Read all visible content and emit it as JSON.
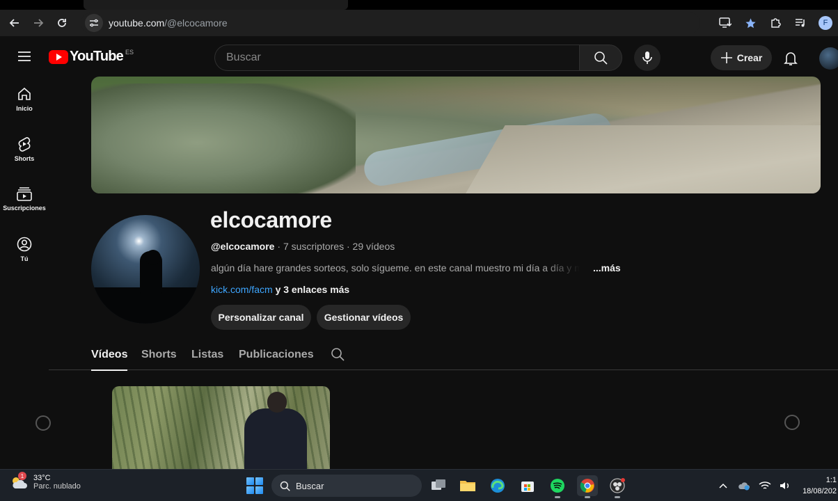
{
  "browser": {
    "url_host": "youtube.com",
    "url_path": "/@elcocamore",
    "profile_initial": "F"
  },
  "masthead": {
    "logo_text": "YouTube",
    "country_code": "ES",
    "search_placeholder": "Buscar",
    "create_label": "Crear"
  },
  "guide": {
    "items": [
      {
        "label": "Inicio",
        "icon": "home-icon"
      },
      {
        "label": "Shorts",
        "icon": "shorts-icon"
      },
      {
        "label": "Suscripciones",
        "icon": "subscriptions-icon"
      },
      {
        "label": "Tú",
        "icon": "you-icon"
      }
    ]
  },
  "channel": {
    "name": "elcocamore",
    "handle": "@elcocamore",
    "subscribers": "7 suscriptores",
    "videos": "29 vídeos",
    "separator": " · ",
    "description": "algún día hare grandes sorteos, solo sígueme. en este canal muestro mi día a día y mis",
    "more_label": "...más",
    "link": "kick.com/facm",
    "more_links": " y 3 enlaces más",
    "customize_label": "Personalizar canal",
    "manage_label": "Gestionar vídeos"
  },
  "tabs": [
    {
      "label": "Vídeos",
      "active": true
    },
    {
      "label": "Shorts",
      "active": false
    },
    {
      "label": "Listas",
      "active": false
    },
    {
      "label": "Publicaciones",
      "active": false
    }
  ],
  "taskbar": {
    "temperature": "33°C",
    "weather": "Parc. nublado",
    "weather_badge": "1",
    "search_label": "Buscar",
    "time": "1:1",
    "date": "18/08/202"
  },
  "colors": {
    "youtube_red": "#ff0000",
    "link_blue": "#3ea6ff",
    "background": "#0f0f0f",
    "pill": "#272727"
  }
}
